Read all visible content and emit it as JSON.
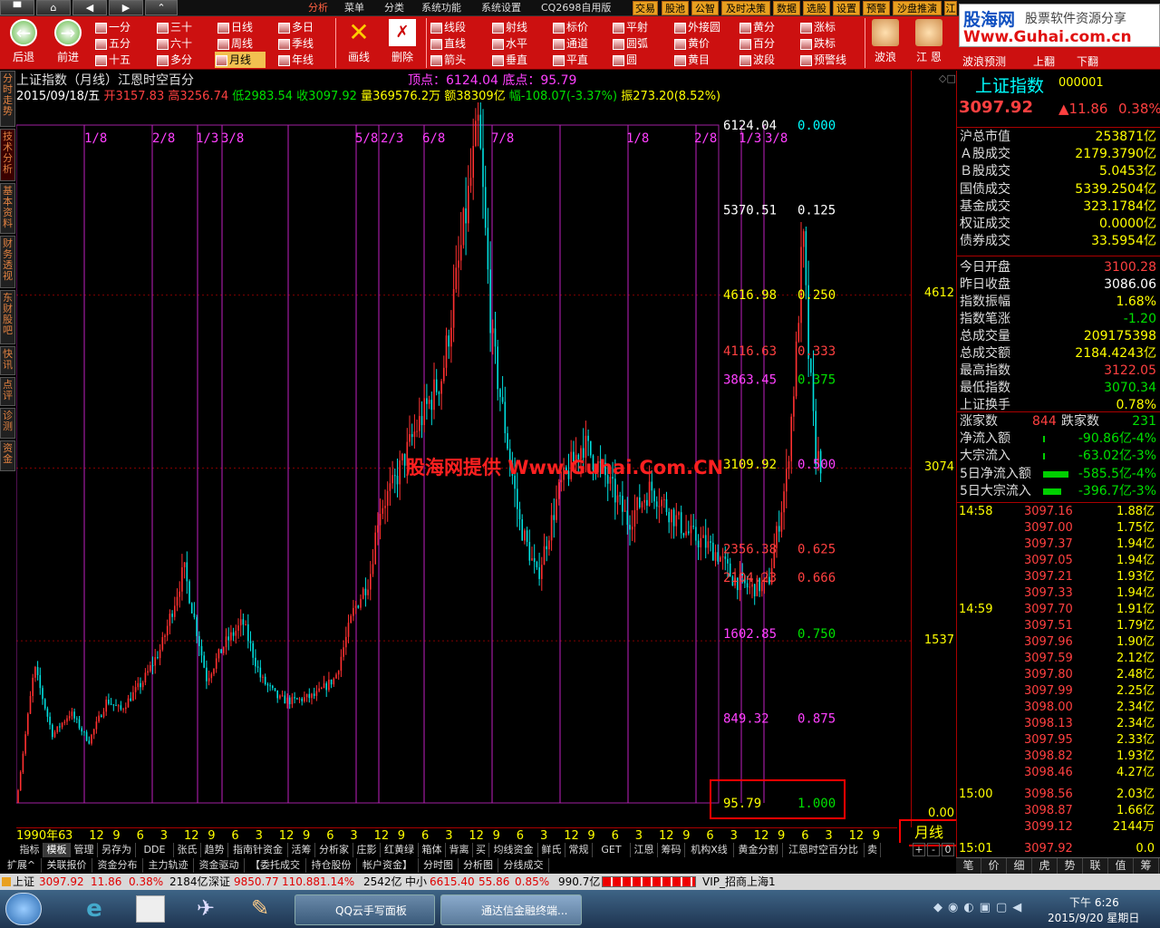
{
  "colors": {
    "up": "#ff3030",
    "down": "#00e0e0",
    "accent": "#ffff00",
    "magenta": "#ff40ff",
    "toolbar": "#cc1010",
    "green": "#00e000"
  },
  "top_nav": {
    "home_icon": "home-icon",
    "back": "◀",
    "forward": "▶",
    "up": "⌃"
  },
  "top_menu": [
    "分析",
    "菜单",
    "分类",
    "系统功能",
    "系统设置",
    "CQ2698自用版"
  ],
  "right_tabs": [
    "交易",
    "股池",
    "公智",
    "及时决策",
    "数据",
    "选股",
    "设置",
    "预警",
    "沙盘推演",
    "江"
  ],
  "watermark_logo": {
    "main": "股海网",
    "sub": "股票软件资源分享",
    "url": "Www.Guhai.com.cn"
  },
  "toolbar": {
    "back": "后退",
    "forward": "前进",
    "periods": [
      "一分",
      "三十",
      "日线",
      "多日",
      "五分",
      "六十",
      "周线",
      "季线",
      "十五",
      "多分",
      "月线",
      "年线"
    ],
    "draw_btn": "画线",
    "delete_btn": "删除",
    "tools": [
      "线段",
      "射线",
      "标价",
      "平射",
      "外接圆",
      "黄分",
      "涨标",
      "直线",
      "水平",
      "通道",
      "圆弧",
      "黄价",
      "百分",
      "跌标",
      "箭头",
      "垂直",
      "平直",
      "圆",
      "黄目",
      "波段",
      "预警线"
    ],
    "right_labels": [
      "波浪",
      "江 恩",
      "波浪预测",
      "上翻",
      "下翻"
    ]
  },
  "side_tabs": [
    "分时走势",
    "技术分析",
    "基本资料",
    "财务透视",
    "东财股吧",
    "快讯",
    "点评",
    "诊测",
    "资金"
  ],
  "chart_header": {
    "title": "上证指数（月线）江恩时空百分",
    "top_label": "顶点：6124.04 底点：95.79",
    "date": "2015/09/18/五",
    "open": "开3157.83",
    "high": "高3256.74",
    "low": "低2983.54",
    "close": "收3097.92",
    "vol": "量369576.2万",
    "amt": "额38309亿",
    "range": "幅-108.07(-3.37%)",
    "amp": "振273.20(8.52%)"
  },
  "watermark": "股海网提供 Www.Guhai.Com.CN",
  "chart_data": {
    "type": "candlestick-monthly",
    "ylim": [
      0,
      6400
    ],
    "price_levels": [
      {
        "price": "6124.04",
        "ratio": "0.000"
      },
      {
        "price": "5370.51",
        "ratio": "0.125"
      },
      {
        "price": "4616.98",
        "ratio": "0.250"
      },
      {
        "price": "4116.63",
        "ratio": "0.333"
      },
      {
        "price": "3863.45",
        "ratio": "0.375"
      },
      {
        "price": "3109.92",
        "ratio": "0.500"
      },
      {
        "price": "2356.38",
        "ratio": "0.625"
      },
      {
        "price": "2104.23",
        "ratio": "0.666"
      },
      {
        "price": "1602.85",
        "ratio": "0.750"
      },
      {
        "price": "849.32",
        "ratio": "0.875"
      },
      {
        "price": "95.79",
        "ratio": "1.000"
      }
    ],
    "level_colors": [
      "#ffffff",
      "#ffffff",
      "#ffff00",
      "#ff4040",
      "#ff40ff",
      "#ffff00",
      "#ff4040",
      "#ff4040",
      "#ff40ff",
      "#ff40ff",
      "#ffff00"
    ],
    "ratio_colors": [
      "#00ffff",
      "#ffffff",
      "#ffff00",
      "#ff4040",
      "#00e000",
      "#ff40ff",
      "#ff4040",
      "#ff4040",
      "#00e000",
      "#ff40ff",
      "#00e000"
    ],
    "time_labels": [
      "1/8",
      "2/8",
      "1/3",
      "3/8",
      "5/8",
      "2/3",
      "6/8",
      "7/8",
      "1/8",
      "2/8",
      "1/3",
      "3/8"
    ],
    "y_axis_labels": [
      "4612",
      "3074",
      "1537",
      "0.00"
    ],
    "x_axis_labels": [
      "1990年6",
      "3",
      "12",
      "9",
      "6",
      "3",
      "12",
      "9",
      "6",
      "3",
      "12",
      "9",
      "6",
      "3",
      "12",
      "9",
      "6",
      "3",
      "12",
      "9",
      "6",
      "3",
      "12",
      "9",
      "6",
      "3",
      "12",
      "9",
      "6",
      "3",
      "12",
      "9",
      "6",
      "3",
      "12",
      "9"
    ],
    "period_label": "月线"
  },
  "tabs_row1": [
    "指标",
    "模板",
    "管理",
    "另存为",
    "DDE",
    "张氏",
    "趋势",
    "指南针资金",
    "活筹",
    "分析家",
    "庄影",
    "红黄绿",
    "箱体",
    "背离",
    "买",
    "均线资金",
    "鲜氏",
    "常规",
    "GET",
    "江恩",
    "筹码",
    "机构X线",
    "黄金分割",
    "江恩时空百分比",
    "卖"
  ],
  "tabs_row1_ctrl": [
    "+",
    "-",
    "0"
  ],
  "tabs_row2": [
    "扩展^",
    "关联报价",
    "资金分布",
    "主力轨迹",
    "资金驱动",
    "【委托成交",
    "持仓股份",
    "帐户资金】",
    "分时图",
    "分析图",
    "分线成交"
  ],
  "right_panel": {
    "name": "上证指数",
    "code": "000001",
    "price": "3097.92",
    "change": "▲11.86",
    "pct": "0.38%",
    "rows": [
      {
        "k": "沪总市值",
        "v": "253871亿",
        "c": "#ffff00"
      },
      {
        "k": "Ａ股成交",
        "v": "2179.3790亿",
        "c": "#ffff00"
      },
      {
        "k": "Ｂ股成交",
        "v": "5.0453亿",
        "c": "#ffff00"
      },
      {
        "k": "国债成交",
        "v": "5339.2504亿",
        "c": "#ffff00"
      },
      {
        "k": "基金成交",
        "v": "323.1784亿",
        "c": "#ffff00"
      },
      {
        "k": "权证成交",
        "v": "0.0000亿",
        "c": "#ffff00"
      },
      {
        "k": "债券成交",
        "v": "33.5954亿",
        "c": "#ffff00"
      },
      {
        "k": "今日开盘",
        "v": "3100.28",
        "c": "#ff4040"
      },
      {
        "k": "昨日收盘",
        "v": "3086.06",
        "c": "#ffffff"
      },
      {
        "k": "指数振幅",
        "v": "1.68%",
        "c": "#ffff00"
      },
      {
        "k": "指数笔涨",
        "v": "-1.20",
        "c": "#00e000"
      },
      {
        "k": "总成交量",
        "v": "209175398",
        "c": "#ffff00"
      },
      {
        "k": "总成交额",
        "v": "2184.4243亿",
        "c": "#ffff00"
      },
      {
        "k": "最高指数",
        "v": "3122.05",
        "c": "#ff4040"
      },
      {
        "k": "最低指数",
        "v": "3070.34",
        "c": "#00e000"
      },
      {
        "k": "上证换手",
        "v": "0.78%",
        "c": "#ffff00"
      }
    ],
    "updown": {
      "up_label": "涨家数",
      "up": "844",
      "down_label": "跌家数",
      "down": "231"
    },
    "flows": [
      {
        "k": "净流入额",
        "v": "-90.86亿",
        "p": "-4%",
        "bar": 0.03
      },
      {
        "k": "大宗流入",
        "v": "-63.02亿",
        "p": "-3%",
        "bar": 0.02
      },
      {
        "k": "5日净流入额",
        "v": "-585.5亿",
        "p": "-4%",
        "bar": 0.55
      },
      {
        "k": "5日大宗流入",
        "v": "-396.7亿",
        "p": "-3%",
        "bar": 0.4
      }
    ],
    "ticks": [
      {
        "t": "14:58",
        "p": "3097.16",
        "q": "1.88亿"
      },
      {
        "t": "",
        "p": "3097.00",
        "q": "1.75亿"
      },
      {
        "t": "",
        "p": "3097.37",
        "q": "1.94亿"
      },
      {
        "t": "",
        "p": "3097.05",
        "q": "1.94亿"
      },
      {
        "t": "",
        "p": "3097.21",
        "q": "1.93亿"
      },
      {
        "t": "",
        "p": "3097.33",
        "q": "1.94亿"
      },
      {
        "t": "14:59",
        "p": "3097.70",
        "q": "1.91亿"
      },
      {
        "t": "",
        "p": "3097.51",
        "q": "1.79亿"
      },
      {
        "t": "",
        "p": "3097.96",
        "q": "1.90亿"
      },
      {
        "t": "",
        "p": "3097.59",
        "q": "2.12亿"
      },
      {
        "t": "",
        "p": "3097.80",
        "q": "2.48亿"
      },
      {
        "t": "",
        "p": "3097.99",
        "q": "2.25亿"
      },
      {
        "t": "",
        "p": "3098.00",
        "q": "2.34亿"
      },
      {
        "t": "",
        "p": "3098.13",
        "q": "2.34亿"
      },
      {
        "t": "",
        "p": "3097.95",
        "q": "2.33亿"
      },
      {
        "t": "",
        "p": "3098.82",
        "q": "1.93亿"
      },
      {
        "t": "",
        "p": "3098.46",
        "q": "4.27亿"
      },
      {
        "t": "15:00",
        "p": "3098.56",
        "q": "2.03亿"
      },
      {
        "t": "",
        "p": "3098.87",
        "q": "1.66亿"
      },
      {
        "t": "",
        "p": "3099.12",
        "q": "2144万"
      },
      {
        "t": "15:01",
        "p": "3097.92",
        "q": "0.0"
      }
    ],
    "bottom_tabs": [
      "笔",
      "价",
      "细",
      "虎",
      "势",
      "联",
      "值",
      "筹"
    ]
  },
  "statusbar": {
    "sh_label": "上证",
    "sh": "3097.92",
    "sh_chg": "11.86",
    "sh_pct": "0.38%",
    "sh_amt": "2184亿",
    "sz_label": "深证",
    "sz": "9850.77",
    "sz_chg": "110.88",
    "sz_pct": "1.14%",
    "sz_amt": "2542亿",
    "zx_label": "中小",
    "zx": "6615.40",
    "zx_chg": "55.86",
    "zx_pct": "0.85%",
    "zx_amt": "990.7亿",
    "vip": "VIP_招商上海1"
  },
  "taskbar": {
    "task1": "QQ云手写面板",
    "task2": "通达信金融终端...",
    "time": "下午 6:26",
    "date": "2015/9/20 星期日"
  }
}
